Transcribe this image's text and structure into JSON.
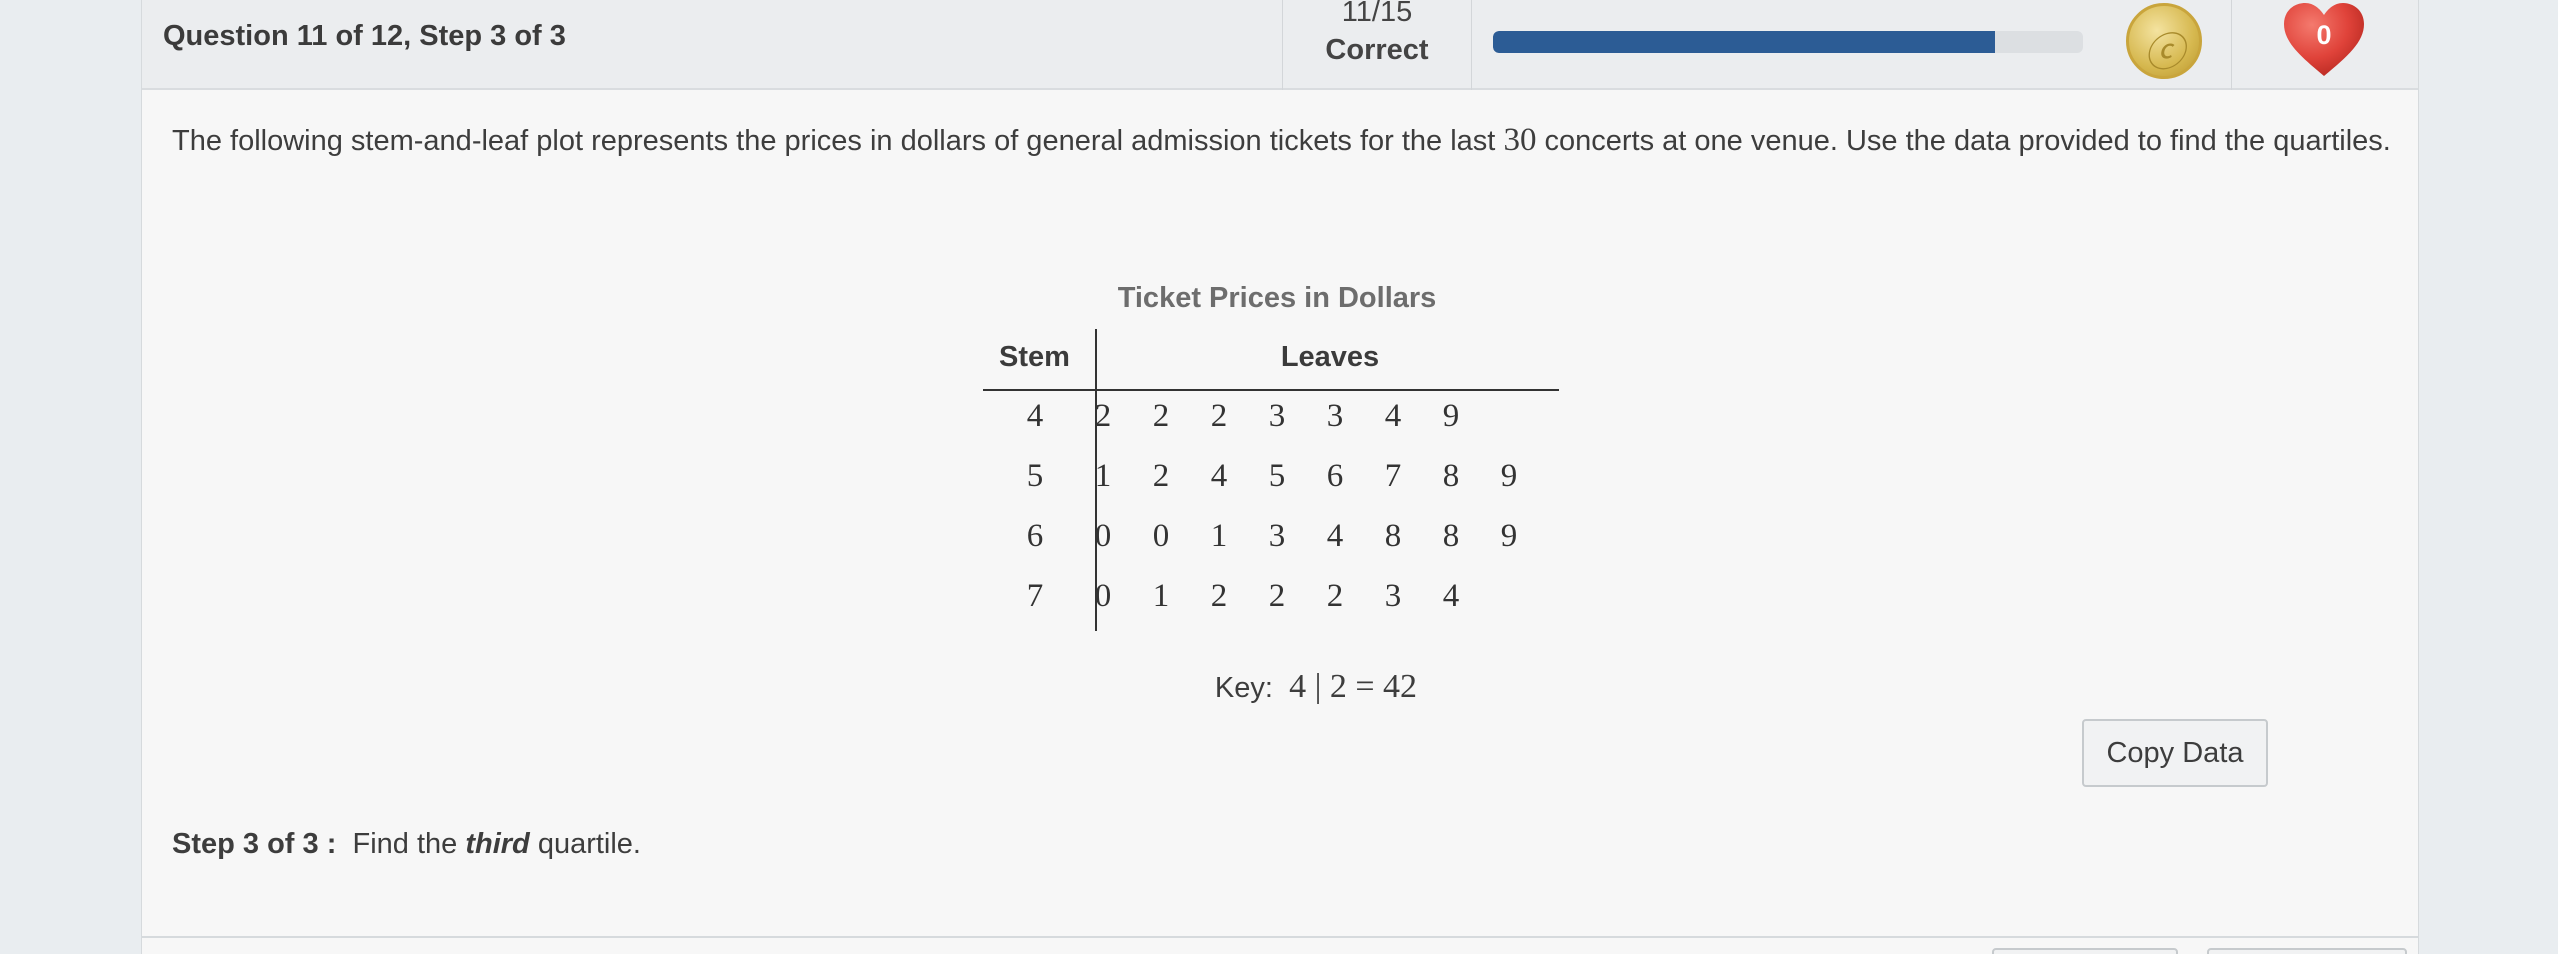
{
  "header": {
    "question_title": "Question 11 of 12, Step 3 of 3",
    "score_fraction": "11/15",
    "score_label": "Correct",
    "progress_fraction": 0.85,
    "progress_color": "#2c5c95",
    "coin_icon": "coin-icon",
    "hearts_count": "0",
    "heart_color": "#e0433a"
  },
  "question": {
    "text_before": "The following stem-and-leaf plot represents the prices in dollars of general admission tickets for the last ",
    "number": "30",
    "text_after": " concerts at one venue. Use the data provided to find the quartiles."
  },
  "stem_leaf": {
    "title": "Ticket Prices in Dollars",
    "stem_header": "Stem",
    "leaves_header": "Leaves",
    "rows": [
      {
        "stem": "4",
        "leaves": [
          "2",
          "2",
          "2",
          "3",
          "3",
          "4",
          "9"
        ]
      },
      {
        "stem": "5",
        "leaves": [
          "1",
          "2",
          "4",
          "5",
          "6",
          "7",
          "8",
          "9"
        ]
      },
      {
        "stem": "6",
        "leaves": [
          "0",
          "0",
          "1",
          "3",
          "4",
          "8",
          "8",
          "9"
        ]
      },
      {
        "stem": "7",
        "leaves": [
          "0",
          "1",
          "2",
          "2",
          "2",
          "3",
          "4"
        ]
      }
    ],
    "key_label": "Key:",
    "key_expr": "4 | 2 = 42"
  },
  "copy_button_label": "Copy Data",
  "step": {
    "label": "Step 3 of 3 :",
    "text_before": "Find the ",
    "emphasis": "third",
    "text_after": " quartile."
  }
}
